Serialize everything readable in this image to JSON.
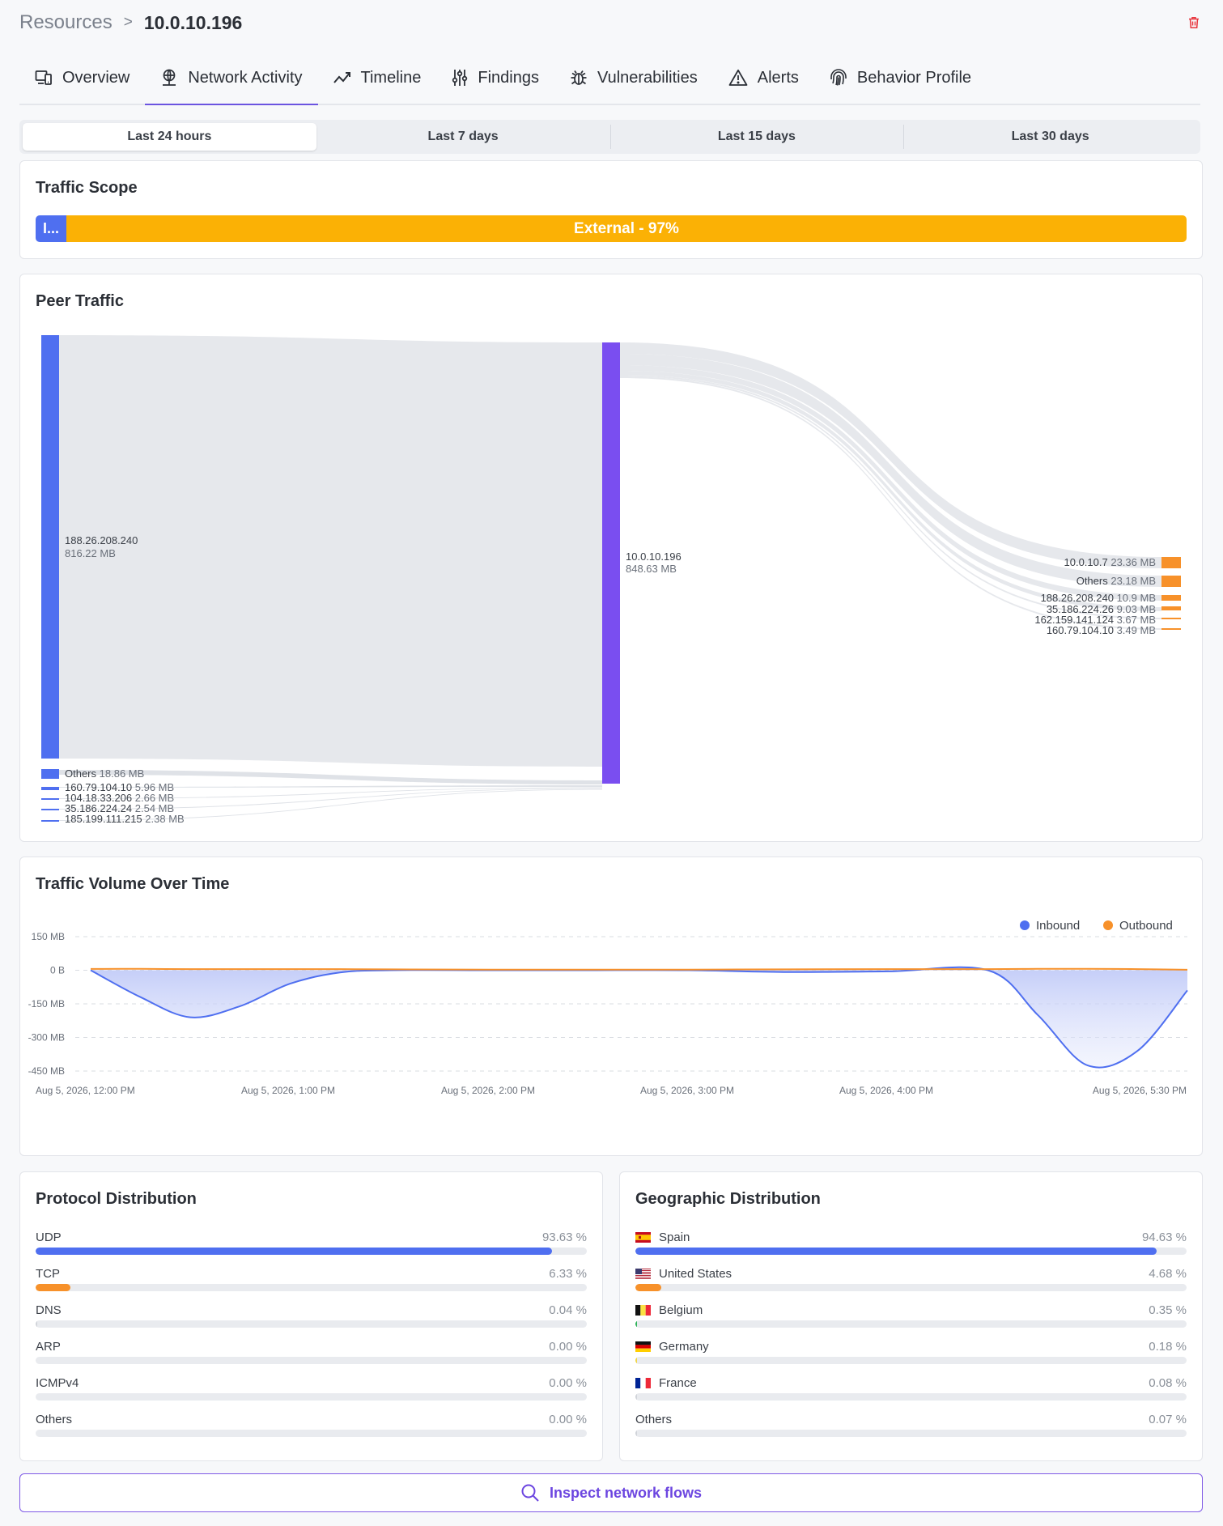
{
  "breadcrumb": {
    "root": "Resources",
    "separator": ">",
    "current": "10.0.10.196"
  },
  "tabs": [
    {
      "label": "Overview",
      "icon": "devices-icon"
    },
    {
      "label": "Network Activity",
      "icon": "network-globe-icon",
      "active": true
    },
    {
      "label": "Timeline",
      "icon": "trend-line-icon"
    },
    {
      "label": "Findings",
      "icon": "sliders-icon"
    },
    {
      "label": "Vulnerabilities",
      "icon": "bug-icon"
    },
    {
      "label": "Alerts",
      "icon": "warning-triangle-icon"
    },
    {
      "label": "Behavior Profile",
      "icon": "fingerprint-icon"
    }
  ],
  "time_ranges": [
    "Last 24 hours",
    "Last 7 days",
    "Last 15 days",
    "Last 30 days"
  ],
  "selected_range": "Last 24 hours",
  "traffic_scope": {
    "title": "Traffic Scope",
    "internal_label": "I...",
    "external_label": "External - 97%",
    "external_fraction": 0.97,
    "colors": {
      "internal": "#4f6ff0",
      "external": "#fbb105"
    }
  },
  "peer_traffic": {
    "title": "Peer Traffic",
    "sources": [
      {
        "name": "188.26.208.240",
        "value": "816.22 MB"
      },
      {
        "name": "Others",
        "value": "18.86 MB"
      },
      {
        "name": "160.79.104.10",
        "value": "5.96 MB"
      },
      {
        "name": "104.18.33.206",
        "value": "2.66 MB"
      },
      {
        "name": "35.186.224.24",
        "value": "2.54 MB"
      },
      {
        "name": "185.199.111.215",
        "value": "2.38 MB"
      }
    ],
    "center": {
      "name": "10.0.10.196",
      "value": "848.63 MB"
    },
    "targets": [
      {
        "name": "10.0.10.7",
        "value": "23.36 MB"
      },
      {
        "name": "Others",
        "value": "23.18 MB"
      },
      {
        "name": "188.26.208.240",
        "value": "10.9 MB"
      },
      {
        "name": "35.186.224.26",
        "value": "9.03 MB"
      },
      {
        "name": "162.159.141.124",
        "value": "3.67 MB"
      },
      {
        "name": "160.79.104.10",
        "value": "3.49 MB"
      }
    ],
    "colors": {
      "source": "#4f6ff0",
      "center": "#7a4ef0",
      "target": "#f7912a",
      "link": "#e6e8ec"
    }
  },
  "traffic_volume": {
    "title": "Traffic Volume Over Time",
    "legend": [
      {
        "name": "Inbound",
        "color": "#4f6ff0"
      },
      {
        "name": "Outbound",
        "color": "#f7912a"
      }
    ]
  },
  "chart_data": {
    "type": "area",
    "y_ticks": [
      "150 MB",
      "0 B",
      "-150 MB",
      "-300 MB",
      "-450 MB"
    ],
    "ylim": [
      -450,
      150
    ],
    "y_unit": "MB",
    "x_ticks": [
      "Aug 5, 2026, 12:00 PM",
      "Aug 5, 2026, 1:00 PM",
      "Aug 5, 2026, 2:00 PM",
      "Aug 5, 2026, 3:00 PM",
      "Aug 5, 2026, 4:00 PM",
      "Aug 5, 2026, 5:30 PM"
    ],
    "grid": true,
    "legend_position": "top-right",
    "series": [
      {
        "name": "Inbound",
        "color": "#4f6ff0",
        "x": [
          "12:00 PM",
          "12:15 PM",
          "12:30 PM",
          "12:45 PM",
          "1:00 PM",
          "1:15 PM",
          "1:30 PM",
          "2:00 PM",
          "2:30 PM",
          "3:00 PM",
          "3:30 PM",
          "4:00 PM",
          "4:30 PM",
          "4:45 PM",
          "5:00 PM",
          "5:15 PM",
          "5:30 PM"
        ],
        "values": [
          0,
          -120,
          -210,
          -160,
          -60,
          -10,
          0,
          0,
          0,
          0,
          -8,
          -5,
          0,
          -200,
          -425,
          -360,
          -90
        ]
      },
      {
        "name": "Outbound",
        "color": "#f7912a",
        "x": [
          "12:00 PM",
          "12:15 PM",
          "12:30 PM",
          "12:45 PM",
          "1:00 PM",
          "1:15 PM",
          "1:30 PM",
          "2:00 PM",
          "2:30 PM",
          "3:00 PM",
          "3:30 PM",
          "4:00 PM",
          "4:30 PM",
          "4:45 PM",
          "5:00 PM",
          "5:15 PM",
          "5:30 PM"
        ],
        "values": [
          6,
          6,
          5,
          5,
          5,
          5,
          4,
          3,
          3,
          3,
          4,
          5,
          5,
          6,
          6,
          5,
          2
        ]
      }
    ]
  },
  "protocol_distribution": {
    "title": "Protocol Distribution",
    "items": [
      {
        "label": "UDP",
        "pct": "93.63 %",
        "value": 93.63,
        "color": "#4f6ff0"
      },
      {
        "label": "TCP",
        "pct": "6.33 %",
        "value": 6.33,
        "color": "#f7912a"
      },
      {
        "label": "DNS",
        "pct": "0.04 %",
        "value": 0.04,
        "color": "#d1d4da"
      },
      {
        "label": "ARP",
        "pct": "0.00 %",
        "value": 0.0,
        "color": "#d1d4da"
      },
      {
        "label": "ICMPv4",
        "pct": "0.00 %",
        "value": 0.0,
        "color": "#d1d4da"
      },
      {
        "label": "Others",
        "pct": "0.00 %",
        "value": 0.0,
        "color": "#d1d4da"
      }
    ]
  },
  "geo_distribution": {
    "title": "Geographic Distribution",
    "items": [
      {
        "label": "Spain",
        "flag": "spain-flag-icon",
        "pct": "94.63 %",
        "value": 94.63,
        "color": "#4f6ff0"
      },
      {
        "label": "United States",
        "flag": "us-flag-icon",
        "pct": "4.68 %",
        "value": 4.68,
        "color": "#f7912a"
      },
      {
        "label": "Belgium",
        "flag": "belgium-flag-icon",
        "pct": "0.35 %",
        "value": 0.35,
        "color": "#2fb35a"
      },
      {
        "label": "Germany",
        "flag": "germany-flag-icon",
        "pct": "0.18 %",
        "value": 0.18,
        "color": "#f0d64a"
      },
      {
        "label": "France",
        "flag": "france-flag-icon",
        "pct": "0.08 %",
        "value": 0.08,
        "color": "#d1d4da"
      },
      {
        "label": "Others",
        "flag": "",
        "pct": "0.07 %",
        "value": 0.07,
        "color": "#d1d4da"
      }
    ]
  },
  "inspect_button": {
    "label": "Inspect network flows"
  }
}
